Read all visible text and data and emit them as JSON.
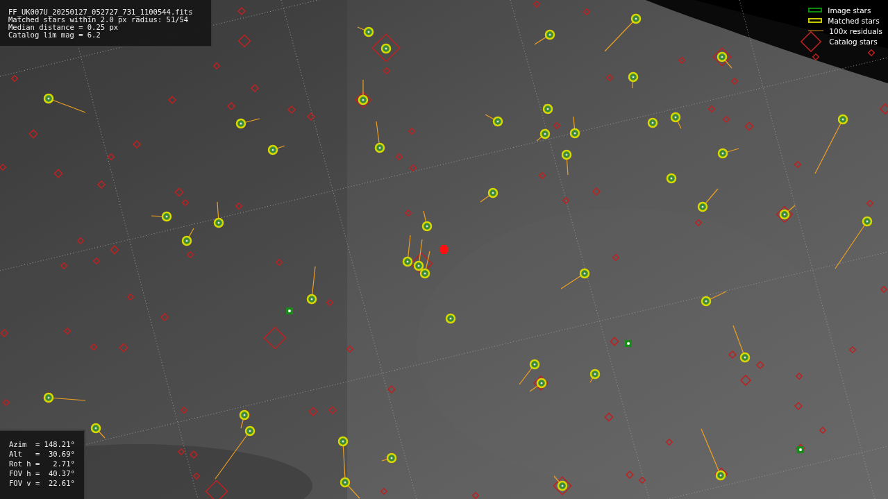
{
  "info_box": {
    "lines": [
      "FF_UK007U_20250127_052727_731_1100544.fits",
      "Matched stars within 2.0 px radius: 51/54",
      "Median distance = 0.25 px",
      "Catalog lim mag = 6.2"
    ]
  },
  "legend": [
    {
      "label": "Image stars"
    },
    {
      "kind": "matched",
      "label": "Matched stars"
    },
    {
      "kind": "residual",
      "label": "100x residuals"
    },
    {
      "kind": "catalog",
      "label": "Catalog stars"
    }
  ],
  "pointing_box": {
    "lines": [
      "Azim  = 148.21°",
      "Alt   =  30.69°",
      "Rot h =   2.71°",
      "FOV h =  40.37°",
      "FOV v =  22.61°"
    ]
  }
}
